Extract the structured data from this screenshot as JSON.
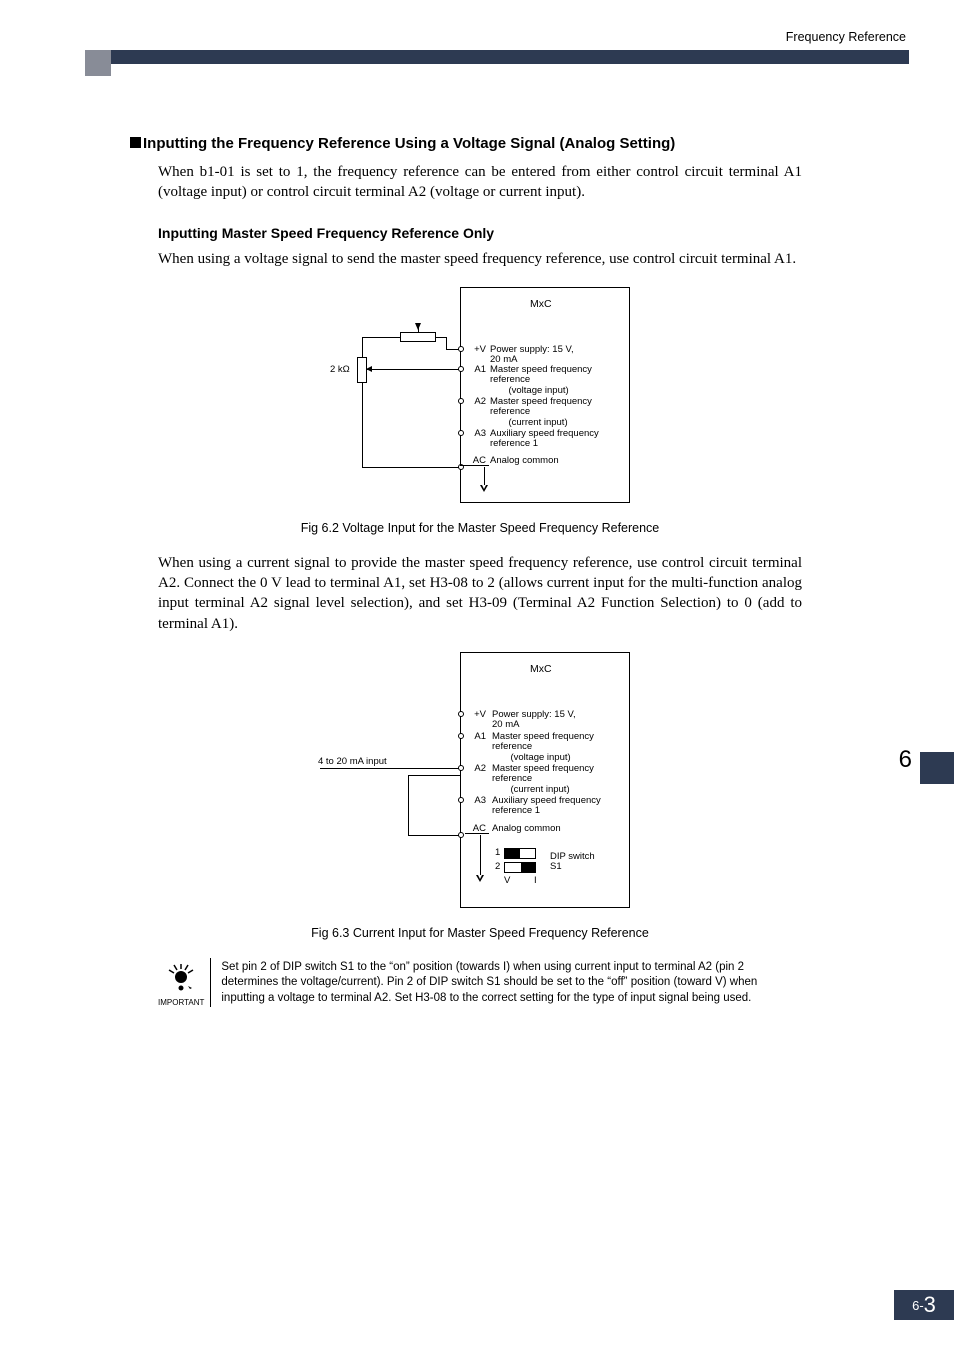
{
  "header": {
    "breadcrumb": "Frequency Reference"
  },
  "section": {
    "title": "Inputting the Frequency Reference Using a Voltage Signal (Analog Setting)",
    "intro": "When b1-01 is set to 1, the frequency reference can be entered from either control circuit terminal A1 (voltage input) or control circuit terminal A2 (voltage or current input).",
    "sub1_title": "Inputting Master Speed Frequency Reference Only",
    "sub1_text": "When using a voltage signal to send the master speed frequency reference, use control circuit terminal A1.",
    "para2": "When using a current signal to provide the master speed frequency reference, use control circuit terminal A2. Connect the 0 V lead to terminal A1, set H3-08 to 2 (allows current input for the multi-function analog input terminal A2 signal level selection), and set H3-09 (Terminal A2 Function Selection) to 0 (add to terminal A1)."
  },
  "fig1": {
    "caption": "Fig 6.2   Voltage Input for the Master Speed Frequency Reference",
    "box_title": "MxC",
    "pot_label": "2 kΩ",
    "terms": {
      "V": {
        "code": "+V",
        "label": "Power supply: 15 V,\n20 mA"
      },
      "A1": {
        "code": "A1",
        "label": "Master speed frequency\nreference\n       (voltage input)"
      },
      "A2": {
        "code": "A2",
        "label": "Master speed frequency\nreference\n       (current input)"
      },
      "A3": {
        "code": "A3",
        "label": "Auxiliary speed frequency\nreference 1"
      },
      "AC": {
        "code": "AC",
        "label": "Analog common"
      }
    }
  },
  "fig2": {
    "caption": "Fig 6.3   Current Input for Master Speed Frequency Reference",
    "box_title": "MxC",
    "left_label": "4 to 20 mA input",
    "terms": {
      "V": {
        "code": "+V",
        "label": "Power supply: 15 V,\n20 mA"
      },
      "A1": {
        "code": "A1",
        "label": "Master speed frequency\nreference\n       (voltage input)"
      },
      "A2": {
        "code": "A2",
        "label": "Master speed frequency\nreference\n       (current input)"
      },
      "A3": {
        "code": "A3",
        "label": "Auxiliary speed frequency\nreference 1"
      },
      "AC": {
        "code": "AC",
        "label": "Analog common"
      }
    },
    "dip": {
      "row1": "1",
      "row2": "2",
      "V": "V",
      "I": "I",
      "label": "DIP switch\nS1"
    }
  },
  "important": {
    "label": "IMPORTANT",
    "text": "Set pin 2 of DIP switch S1 to the “on” position (towards I) when using current input to terminal A2 (pin 2 determines the voltage/current). Pin 2 of DIP switch S1 should be set to the “off” position (toward V) when inputting a voltage to terminal A2. Set H3-08 to the correct setting for the type of input signal being used."
  },
  "sidebar": {
    "chapter": "6"
  },
  "footer": {
    "prefix": "6-",
    "page": "3"
  }
}
